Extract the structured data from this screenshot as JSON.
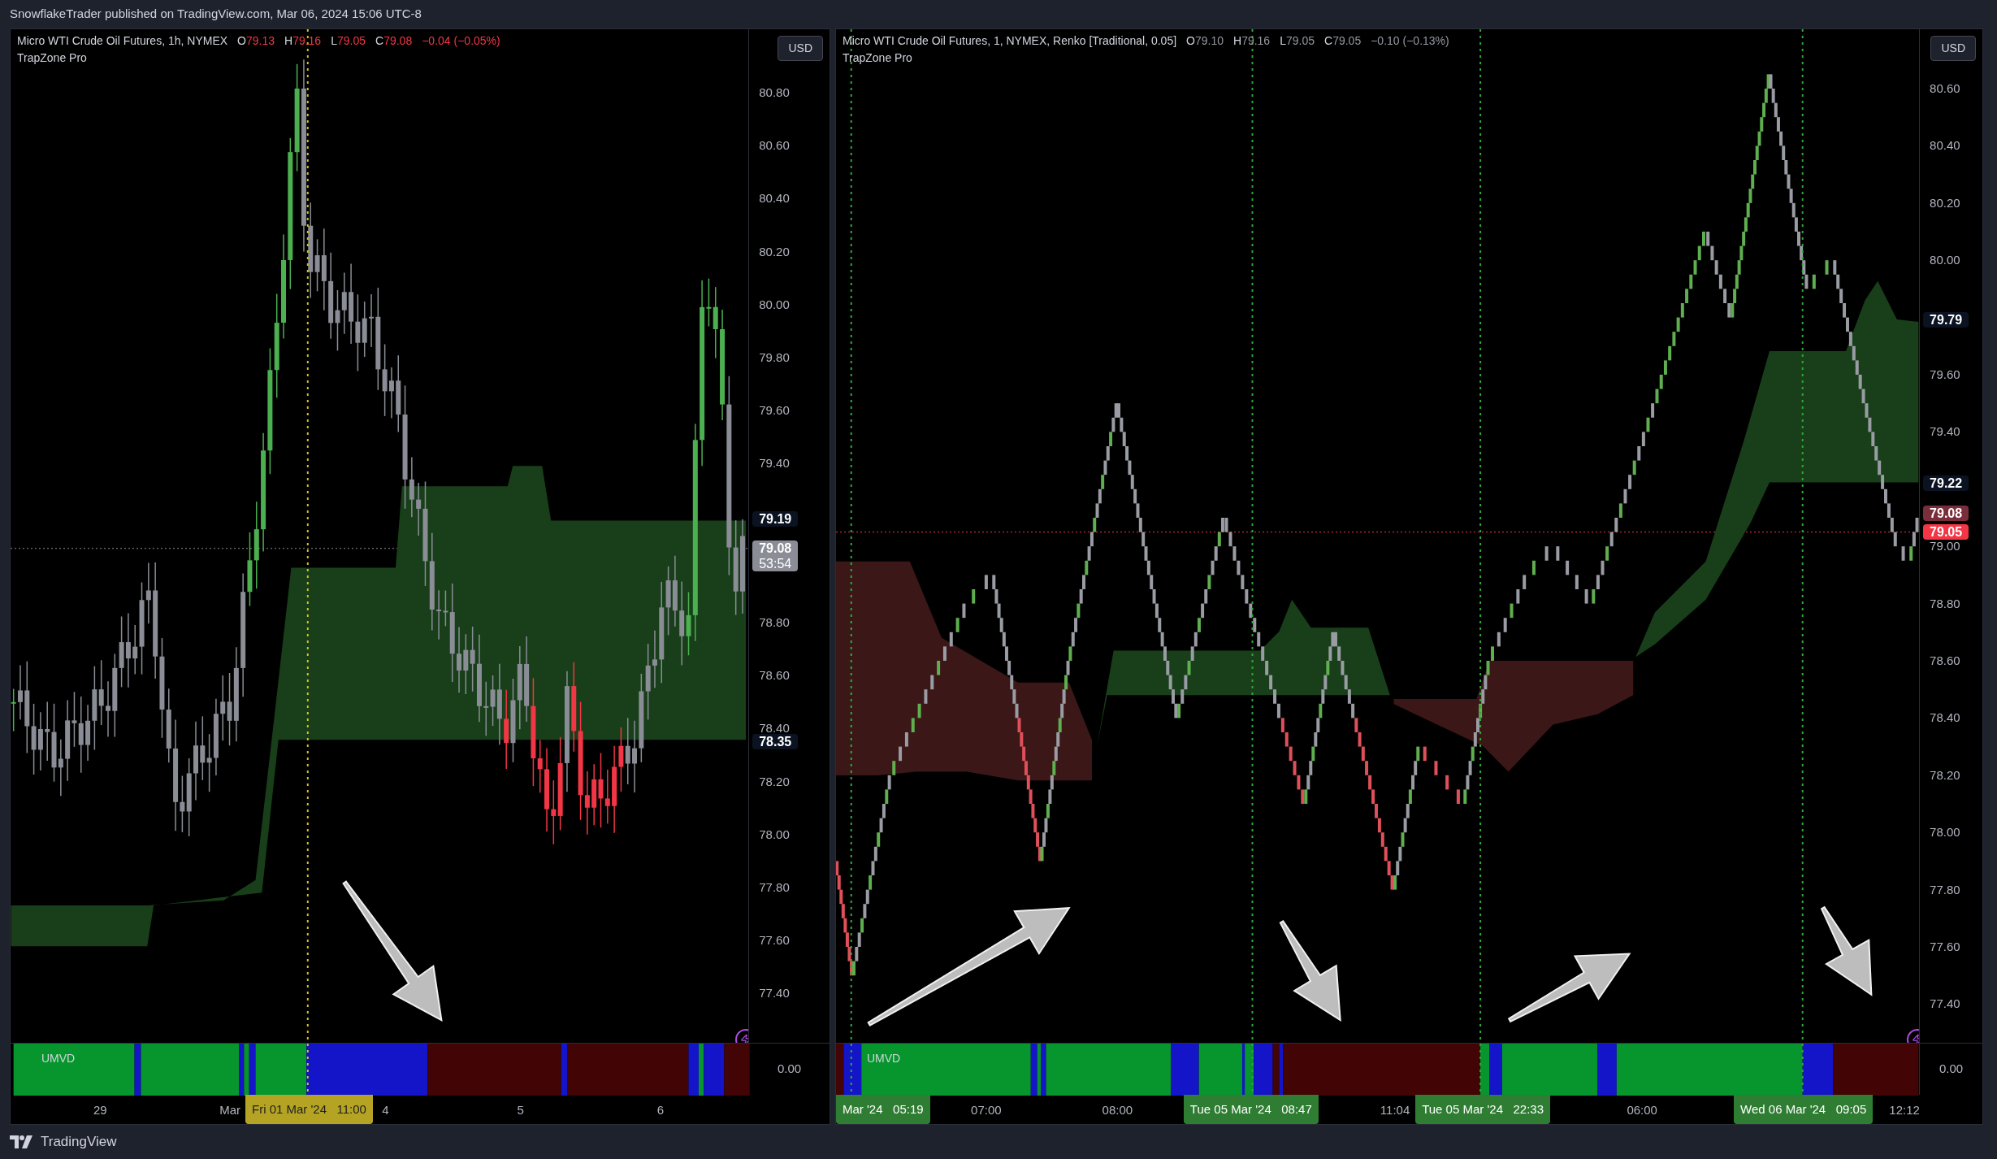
{
  "publish_line": "SnowflakeTrader published on TradingView.com, Mar 06, 2024 15:06 UTC-8",
  "charts": [
    {
      "legend": {
        "title": "Micro WTI Crude Oil Futures, 1h, NYMEX",
        "values": [
          {
            "label": "O",
            "value": "79.13"
          },
          {
            "label": "H",
            "value": "79.16"
          },
          {
            "label": "L",
            "value": "79.05"
          },
          {
            "label": "C",
            "value": "79.08"
          }
        ],
        "change": "−0.04 (−0.05%)",
        "colored": true
      },
      "indicator": "TrapZone Pro",
      "currency": "USD",
      "price_ticks": [
        "80.80",
        "80.60",
        "80.40",
        "80.20",
        "80.00",
        "79.80",
        "79.60",
        "79.40",
        "78.80",
        "78.60",
        "78.40",
        "78.20",
        "78.00",
        "77.80",
        "77.60",
        "77.40"
      ],
      "price_labels": [
        {
          "text": "79.19",
          "kind": "level"
        },
        {
          "text": "79.08",
          "sub": "53:54",
          "kind": "countdown"
        },
        {
          "text": "78.35",
          "kind": "level"
        }
      ],
      "oscillator": {
        "name": "UMVD",
        "value": "0.00"
      },
      "time_labels": [
        {
          "text": "29",
          "kind": "tick"
        },
        {
          "text": "Mar",
          "kind": "tick"
        },
        {
          "text": "Fri 01 Mar '24   11:00",
          "kind": "badge"
        },
        {
          "text": "4",
          "kind": "tick"
        },
        {
          "text": "5",
          "kind": "tick"
        },
        {
          "text": "6",
          "kind": "tick"
        }
      ]
    },
    {
      "legend": {
        "title": "Micro WTI Crude Oil Futures, 1, NYMEX, Renko [Traditional, 0.05]",
        "values": [
          {
            "label": "O",
            "value": "79.10"
          },
          {
            "label": "H",
            "value": "79.16"
          },
          {
            "label": "L",
            "value": "79.05"
          },
          {
            "label": "C",
            "value": "79.05"
          }
        ],
        "change": "−0.10 (−0.13%)",
        "colored": false
      },
      "indicator": "TrapZone Pro",
      "currency": "USD",
      "price_ticks": [
        "80.60",
        "80.40",
        "80.20",
        "80.00",
        "79.60",
        "79.40",
        "79.00",
        "78.80",
        "78.60",
        "78.40",
        "78.20",
        "78.00",
        "77.80",
        "77.60",
        "77.40"
      ],
      "price_labels": [
        {
          "text": "79.79",
          "kind": "level"
        },
        {
          "text": "79.22",
          "kind": "level"
        },
        {
          "text": "79.08",
          "kind": "previous"
        },
        {
          "text": "79.05",
          "kind": "last"
        }
      ],
      "oscillator": {
        "name": "UMVD",
        "value": "0.00"
      },
      "time_labels": [
        {
          "text": "Mar '24   05:19",
          "kind": "badge"
        },
        {
          "text": "07:00",
          "kind": "tick"
        },
        {
          "text": "08:00",
          "kind": "tick"
        },
        {
          "text": "Tue 05 Mar '24   08:47",
          "kind": "badge"
        },
        {
          "text": "11:04",
          "kind": "tick"
        },
        {
          "text": "Tue 05 Mar '24   22:33",
          "kind": "badge"
        },
        {
          "text": "06:00",
          "kind": "tick"
        },
        {
          "text": "Wed 06 Mar '24   09:05",
          "kind": "badge"
        },
        {
          "text": "12:12",
          "kind": "tick"
        }
      ]
    }
  ],
  "footer": {
    "brand": "TradingView"
  }
}
